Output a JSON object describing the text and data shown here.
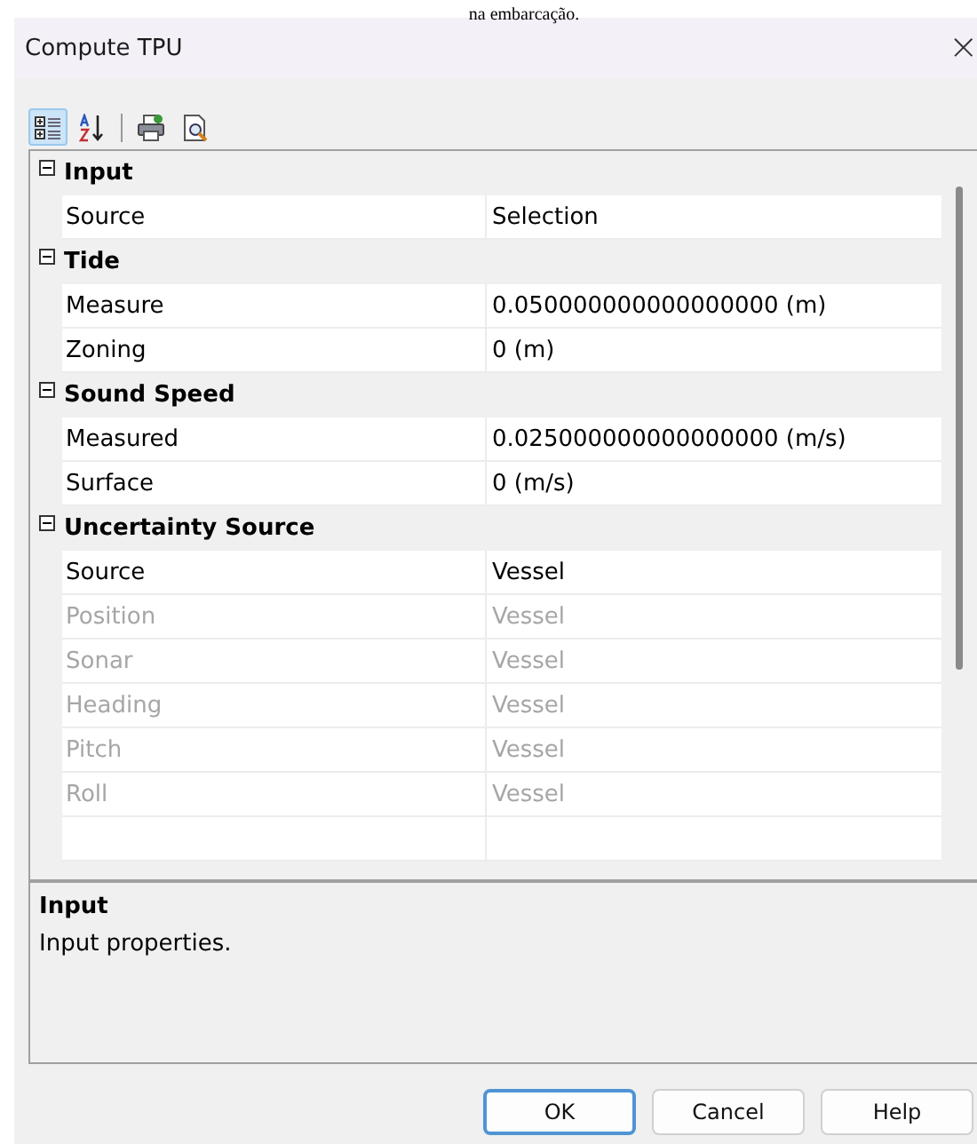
{
  "caption": "na embarcação.",
  "window": {
    "title": "Compute TPU",
    "close": "×"
  },
  "toolbar": {
    "view_modes": [
      {
        "kind": "categorized",
        "selected": true
      },
      {
        "kind": "alphabetical",
        "selected": false
      }
    ],
    "actions": [
      {
        "kind": "print"
      },
      {
        "kind": "preview"
      }
    ]
  },
  "grid": {
    "categories": [
      {
        "name": "Input",
        "expanded": true,
        "properties": [
          {
            "name": "Source",
            "value": "Selection",
            "disabled": false
          }
        ]
      },
      {
        "name": "Tide",
        "expanded": true,
        "properties": [
          {
            "name": "Measure",
            "value": "0.050000000000000000 (m)",
            "disabled": false
          },
          {
            "name": "Zoning",
            "value": "0 (m)",
            "disabled": false
          }
        ]
      },
      {
        "name": "Sound Speed",
        "expanded": true,
        "properties": [
          {
            "name": "Measured",
            "value": "0.025000000000000000 (m/s)",
            "disabled": false
          },
          {
            "name": "Surface",
            "value": "0 (m/s)",
            "disabled": false
          }
        ]
      },
      {
        "name": "Uncertainty Source",
        "expanded": true,
        "properties": [
          {
            "name": "Source",
            "value": "Vessel",
            "disabled": false
          },
          {
            "name": "Position",
            "value": "Vessel",
            "disabled": true
          },
          {
            "name": "Sonar",
            "value": "Vessel",
            "disabled": true
          },
          {
            "name": "Heading",
            "value": "Vessel",
            "disabled": true
          },
          {
            "name": "Pitch",
            "value": "Vessel",
            "disabled": true
          },
          {
            "name": "Roll",
            "value": "Vessel",
            "disabled": true
          }
        ]
      }
    ]
  },
  "description": {
    "title": "Input",
    "text": "Input properties."
  },
  "buttons": [
    {
      "label": "OK",
      "default": true
    },
    {
      "label": "Cancel",
      "default": false
    },
    {
      "label": "Help",
      "default": false
    }
  ]
}
